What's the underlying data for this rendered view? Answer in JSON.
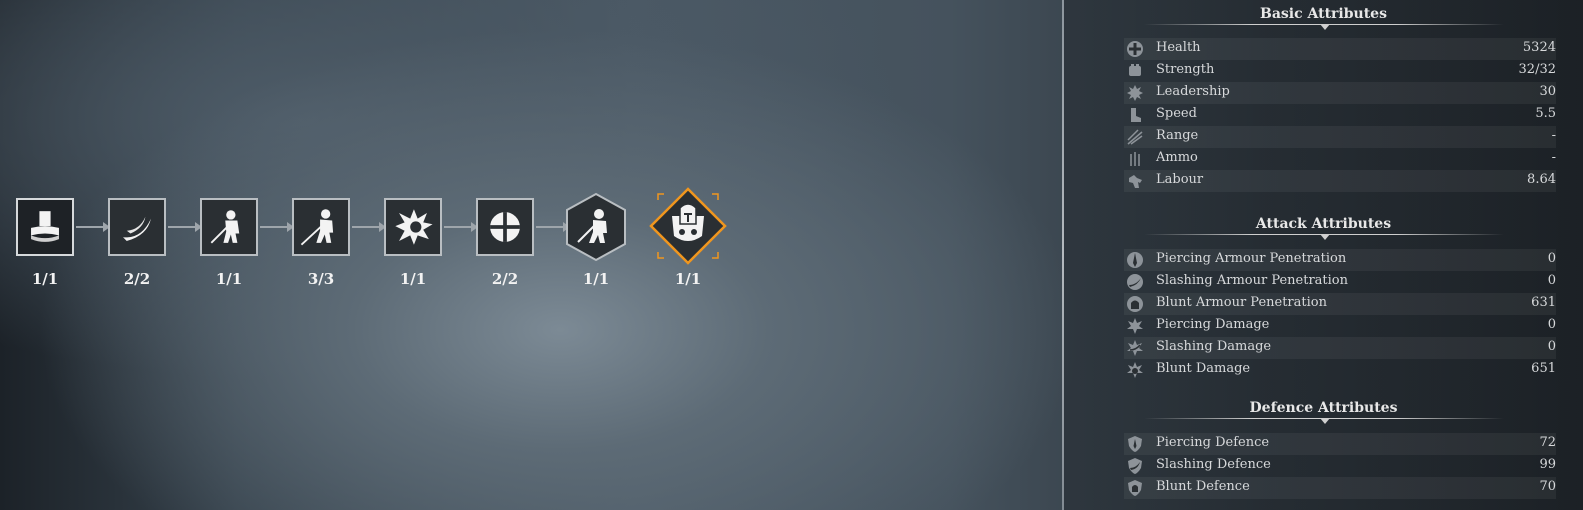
{
  "upgrade_chain": {
    "nodes": [
      {
        "icon": "helmet-base-icon",
        "count": "1/1",
        "shape": "square"
      },
      {
        "icon": "slash-arc-icon",
        "count": "2/2",
        "shape": "square"
      },
      {
        "icon": "knight-sword-icon",
        "count": "1/1",
        "shape": "square"
      },
      {
        "icon": "knight-spear-icon",
        "count": "3/3",
        "shape": "square"
      },
      {
        "icon": "impact-burst-icon",
        "count": "1/1",
        "shape": "square"
      },
      {
        "icon": "cross-shield-icon",
        "count": "2/2",
        "shape": "square"
      },
      {
        "icon": "knight-charge-icon",
        "count": "1/1",
        "shape": "hexagon"
      },
      {
        "icon": "crested-helm-emblem-icon",
        "count": "1/1",
        "shape": "diamond"
      }
    ],
    "colors": {
      "highlight": "#f0961e",
      "node_border": "#b9bec2"
    }
  },
  "basic_attributes": {
    "title": "Basic Attributes",
    "rows": [
      {
        "icon": "health-cross-icon",
        "label": "Health",
        "value": "5324"
      },
      {
        "icon": "strength-fist-icon",
        "label": "Strength",
        "value": "32/32"
      },
      {
        "icon": "leadership-sun-icon",
        "label": "Leadership",
        "value": "30"
      },
      {
        "icon": "speed-boot-icon",
        "label": "Speed",
        "value": "5.5"
      },
      {
        "icon": "range-arrows-icon",
        "label": "Range",
        "value": "-"
      },
      {
        "icon": "ammo-arrows-icon",
        "label": "Ammo",
        "value": "-"
      },
      {
        "icon": "labour-hand-icon",
        "label": "Labour",
        "value": "8.64"
      }
    ]
  },
  "attack_attributes": {
    "title": "Attack Attributes",
    "rows": [
      {
        "icon": "piercing-penetration-icon",
        "label": "Piercing Armour Penetration",
        "value": "0"
      },
      {
        "icon": "slashing-penetration-icon",
        "label": "Slashing Armour Penetration",
        "value": "0"
      },
      {
        "icon": "blunt-penetration-icon",
        "label": "Blunt Armour Penetration",
        "value": "631"
      },
      {
        "icon": "piercing-damage-icon",
        "label": "Piercing Damage",
        "value": "0"
      },
      {
        "icon": "slashing-damage-icon",
        "label": "Slashing Damage",
        "value": "0"
      },
      {
        "icon": "blunt-damage-icon",
        "label": "Blunt Damage",
        "value": "651"
      }
    ]
  },
  "defence_attributes": {
    "title": "Defence Attributes",
    "rows": [
      {
        "icon": "piercing-defence-icon",
        "label": "Piercing Defence",
        "value": "72"
      },
      {
        "icon": "slashing-defence-icon",
        "label": "Slashing Defence",
        "value": "99"
      },
      {
        "icon": "blunt-defence-icon",
        "label": "Blunt Defence",
        "value": "70"
      }
    ]
  }
}
